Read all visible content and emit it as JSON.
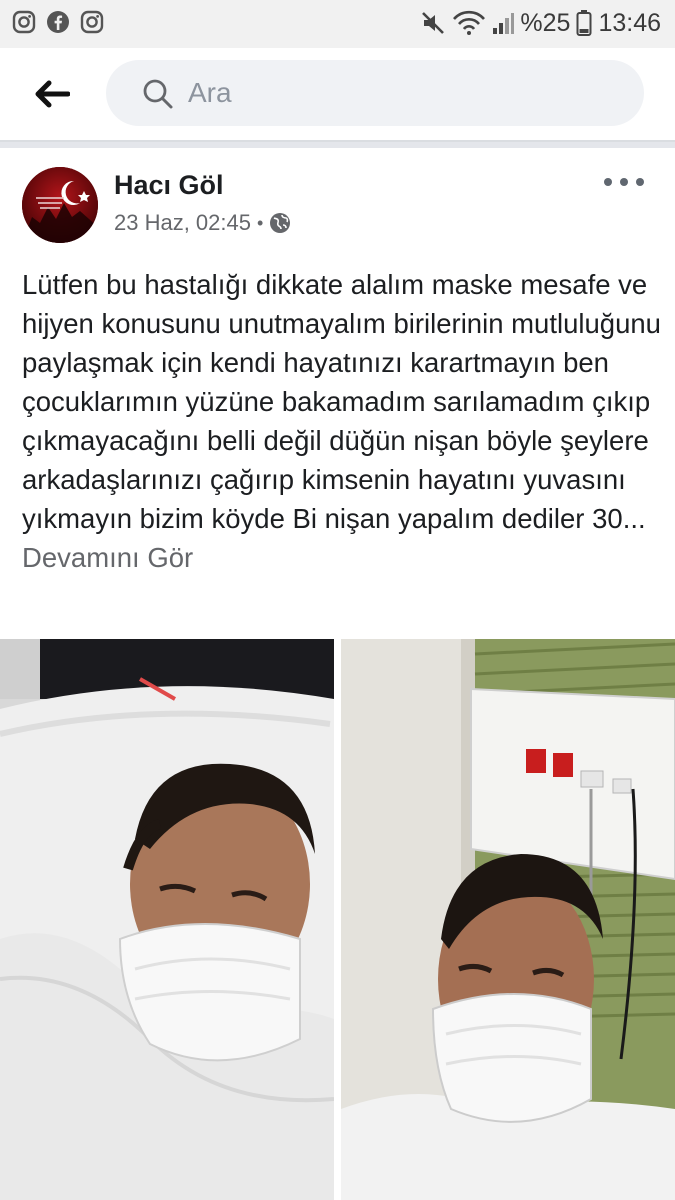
{
  "status_bar": {
    "battery": "%25",
    "time": "13:46",
    "app_icons": [
      "instagram-icon",
      "facebook-icon",
      "instagram-icon"
    ],
    "system_icons": [
      "mute-icon",
      "wifi-icon",
      "signal-icon",
      "battery-icon"
    ]
  },
  "header": {
    "search_placeholder": "Ara"
  },
  "post": {
    "author": "Hacı Göl",
    "timestamp": "23 Haz, 02:45",
    "meta_separator": "•",
    "text": "Lütfen bu hastalığı dikkate alalım maske mesafe ve hijyen konusunu unutmayalım birilerinin mutluluğunu paylaşmak için kendi hayatınızı karartmayın ben çocuklarımın yüzüne bakamadım sarılamadım çıkıp çıkmayacağını belli değil düğün nişan böyle şeylere arkadaşlarınızı çağırıp kimsenin hayatını yuvasını yıkmayın bizim köyde Bi nişan yapalım dediler 30...",
    "see_more": "Devamını Gör",
    "photo_count": 2
  },
  "colors": {
    "accent_text": "#1c1e21",
    "secondary_text": "#65676b",
    "search_bg": "#f0f2f5",
    "divider": "#e4e6eb"
  }
}
